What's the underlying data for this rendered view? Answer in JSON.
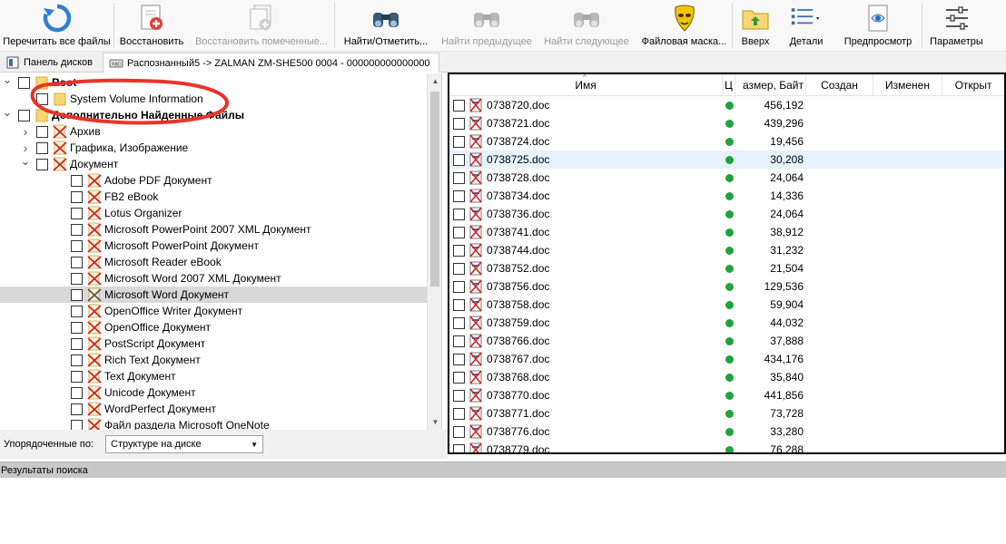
{
  "toolbar": {
    "buttons": [
      {
        "label": "Перечитать все файлы",
        "icon": "refresh-icon",
        "disabled": false
      },
      {
        "label": "Восстановить",
        "icon": "restore-icon",
        "disabled": false
      },
      {
        "label": "Восстановить помеченные...",
        "icon": "restore-marked-icon",
        "disabled": true
      },
      {
        "label": "Найти/Отметить...",
        "icon": "binoculars-icon",
        "disabled": false
      },
      {
        "label": "Найти предыдущее",
        "icon": "find-previous-icon",
        "disabled": true
      },
      {
        "label": "Найти следующее",
        "icon": "find-next-icon",
        "disabled": true
      },
      {
        "label": "Файловая маска...",
        "icon": "file-mask-icon",
        "disabled": false
      },
      {
        "label": "Вверх",
        "icon": "folder-up-icon",
        "disabled": false
      },
      {
        "label": "Детали",
        "icon": "details-view-icon",
        "disabled": false
      },
      {
        "label": "Предпросмотр",
        "icon": "preview-eye-icon",
        "disabled": false
      },
      {
        "label": "Параметры",
        "icon": "settings-sliders-icon",
        "disabled": false
      }
    ]
  },
  "tabs": {
    "disks_panel": "Панель дисков",
    "active_tab": "Распознанный5 -> ZALMAN ZM-SHE500 0004 - 000000000000000"
  },
  "tree": {
    "items": [
      {
        "label": "Root",
        "level": 0,
        "bold": true,
        "expanded": true,
        "icon": "folder-icon"
      },
      {
        "label": "System Volume Information",
        "level": 1,
        "bold": false,
        "icon": "folder-icon"
      },
      {
        "label": "Дополнительно Найденные Файлы",
        "level": 0,
        "bold": true,
        "expanded": true,
        "icon": "folder-icon"
      },
      {
        "label": "Архив",
        "level": 1,
        "bold": false,
        "collapsed": true,
        "icon": "deleted-x-icon"
      },
      {
        "label": "Графика, Изображение",
        "level": 1,
        "bold": false,
        "collapsed": true,
        "icon": "deleted-x-icon"
      },
      {
        "label": "Документ",
        "level": 1,
        "bold": false,
        "expanded": true,
        "icon": "deleted-x-icon"
      },
      {
        "label": "Adobe PDF Документ",
        "level": 2,
        "icon": "deleted-x-icon"
      },
      {
        "label": "FB2 eBook",
        "level": 2,
        "icon": "deleted-x-icon"
      },
      {
        "label": "Lotus Organizer",
        "level": 2,
        "icon": "deleted-x-icon"
      },
      {
        "label": "Microsoft PowerPoint 2007 XML Документ",
        "level": 2,
        "icon": "deleted-x-icon"
      },
      {
        "label": "Microsoft PowerPoint Документ",
        "level": 2,
        "icon": "deleted-x-icon"
      },
      {
        "label": "Microsoft Reader eBook",
        "level": 2,
        "icon": "deleted-x-icon"
      },
      {
        "label": "Microsoft Word 2007 XML Документ",
        "level": 2,
        "icon": "deleted-x-icon"
      },
      {
        "label": "Microsoft Word Документ",
        "level": 2,
        "icon": "deleted-x-icon",
        "selected": true
      },
      {
        "label": "OpenOffice Writer Документ",
        "level": 2,
        "icon": "deleted-x-icon"
      },
      {
        "label": "OpenOffice Документ",
        "level": 2,
        "icon": "deleted-x-icon"
      },
      {
        "label": "PostScript Документ",
        "level": 2,
        "icon": "deleted-x-icon"
      },
      {
        "label": "Rich Text Документ",
        "level": 2,
        "icon": "deleted-x-icon"
      },
      {
        "label": "Text Документ",
        "level": 2,
        "icon": "deleted-x-icon"
      },
      {
        "label": "Unicode Документ",
        "level": 2,
        "icon": "deleted-x-icon"
      },
      {
        "label": "WordPerfect Документ",
        "level": 2,
        "icon": "deleted-x-icon"
      },
      {
        "label": "Файл раздела Microsoft OneNote",
        "level": 2,
        "icon": "deleted-x-icon"
      }
    ]
  },
  "order_by": {
    "label": "Упорядоченные по:",
    "value": "Структуре на диске"
  },
  "file_list": {
    "columns": {
      "name": "Имя",
      "c": "Ц",
      "size": "азмер, Байт",
      "created": "Создан",
      "modified": "Изменен",
      "opened": "Открыт"
    },
    "files": [
      {
        "name": "0738720.doc",
        "size": "456,192"
      },
      {
        "name": "0738721.doc",
        "size": "439,296"
      },
      {
        "name": "0738724.doc",
        "size": "19,456"
      },
      {
        "name": "0738725.doc",
        "size": "30,208",
        "hover": true
      },
      {
        "name": "0738728.doc",
        "size": "24,064"
      },
      {
        "name": "0738734.doc",
        "size": "14,336"
      },
      {
        "name": "0738736.doc",
        "size": "24,064"
      },
      {
        "name": "0738741.doc",
        "size": "38,912"
      },
      {
        "name": "0738744.doc",
        "size": "31,232"
      },
      {
        "name": "0738752.doc",
        "size": "21,504"
      },
      {
        "name": "0738756.doc",
        "size": "129,536"
      },
      {
        "name": "0738758.doc",
        "size": "59,904"
      },
      {
        "name": "0738759.doc",
        "size": "44,032"
      },
      {
        "name": "0738766.doc",
        "size": "37,888"
      },
      {
        "name": "0738767.doc",
        "size": "434,176"
      },
      {
        "name": "0738768.doc",
        "size": "35,840"
      },
      {
        "name": "0738770.doc",
        "size": "441,856"
      },
      {
        "name": "0738771.doc",
        "size": "73,728"
      },
      {
        "name": "0738776.doc",
        "size": "33,280"
      },
      {
        "name": "0738779.doc",
        "size": "76,288"
      }
    ]
  },
  "search_results": {
    "title": "Результаты поиска"
  },
  "colors": {
    "status_green": "#1fa33a",
    "deleted_red": "#d42020",
    "folder_yellow": "#f7d774",
    "annotation_red": "#e8342a",
    "selection_gray": "#d9d9d9",
    "hover_blue": "#e5f3ff"
  }
}
